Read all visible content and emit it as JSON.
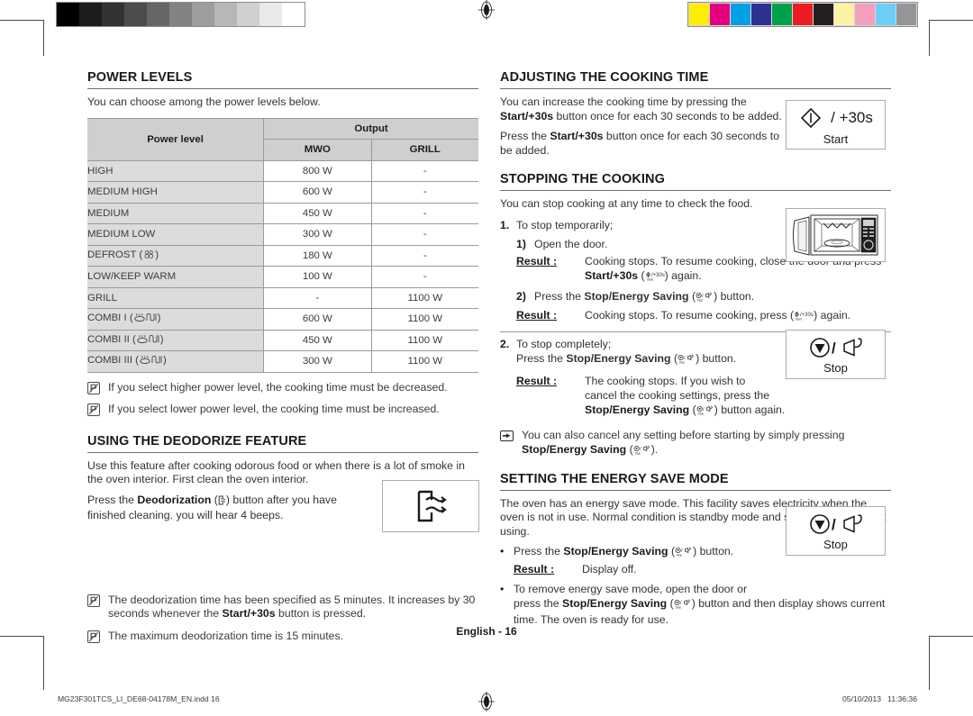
{
  "document": {
    "page_label": "English - 16",
    "footer_file": "MG23F301TCS_LI_DE68-04178M_EN.indd   16",
    "footer_page_num": "16",
    "footer_date": "05/10/2013   11:36:36"
  },
  "calibration": {
    "gray_bar_name": "grayscale-calibration-bar",
    "gray_steps": [
      "#000000",
      "#1c1c1c",
      "#323232",
      "#4c4c4c",
      "#666666",
      "#828282",
      "#9e9e9e",
      "#b7b7b7",
      "#d0d0d0",
      "#e9e9e9",
      "#ffffff"
    ],
    "color_bar_name": "color-calibration-bar",
    "color_steps": [
      "#ffed00",
      "#e5007d",
      "#00a0e4",
      "#2e3192",
      "#00a14b",
      "#ed1c24",
      "#231f20",
      "#fbf2a6",
      "#f4a0bd",
      "#6dcff6",
      "#939598"
    ]
  },
  "left_column": {
    "power_levels": {
      "title": "POWER LEVELS",
      "intro": "You can choose among the power levels below.",
      "table": {
        "header_power_level": "Power level",
        "header_output": "Output",
        "header_mwo": "MWO",
        "header_grill": "GRILL",
        "rows": [
          {
            "level": "HIGH",
            "icon": "",
            "mwo": "800 W",
            "grill": "-"
          },
          {
            "level": "MEDIUM HIGH",
            "icon": "",
            "mwo": "600 W",
            "grill": "-"
          },
          {
            "level": "MEDIUM",
            "icon": "",
            "mwo": "450 W",
            "grill": "-"
          },
          {
            "level": "MEDIUM LOW",
            "icon": "",
            "mwo": "300 W",
            "grill": "-"
          },
          {
            "level": "DEFROST",
            "icon": "defrost-icon",
            "mwo": "180 W",
            "grill": "-"
          },
          {
            "level": "LOW/KEEP WARM",
            "icon": "",
            "mwo": "100 W",
            "grill": "-"
          },
          {
            "level": "GRILL",
            "icon": "",
            "mwo": "-",
            "grill": "1100 W"
          },
          {
            "level": "COMBI I",
            "icon": "combi-icon",
            "mwo": "600 W",
            "grill": "1100 W"
          },
          {
            "level": "COMBI II",
            "icon": "combi-icon",
            "mwo": "450 W",
            "grill": "1100 W"
          },
          {
            "level": "COMBI III",
            "icon": "combi-icon",
            "mwo": "300 W",
            "grill": "1100 W"
          }
        ]
      },
      "notes": [
        "If you select higher power level, the cooking time must be decreased.",
        "If you select lower power level, the cooking time must be increased."
      ]
    },
    "deodorize": {
      "title": "USING THE DEODORIZE FEATURE",
      "para1": "Use this feature after cooking odorous food or when there is a lot of smoke in the oven interior. First clean the oven interior.",
      "para2_pre": "Press the ",
      "para2_bold": "Deodorization",
      "para2_mid": " (",
      "para2_post": ") button after you have finished cleaning. you will hear 4 beeps.",
      "notes": [
        {
          "pre": "The deodorization time has been specified as 5 minutes. It increases by 30 seconds whenever the ",
          "bold": "Start/+30s",
          "post": " button is pressed."
        },
        {
          "pre": "The maximum deodorization time is 15 minutes.",
          "bold": "",
          "post": ""
        }
      ],
      "figure_name": "deodorization-icon-box"
    }
  },
  "right_column": {
    "adjusting": {
      "title": "ADJUSTING THE COOKING TIME",
      "para1_pre": "You can increase the cooking time by pressing the ",
      "para1_bold": "Start/+30s",
      "para1_post": " button once for each 30 seconds to be added.",
      "para2_pre": "Press the ",
      "para2_bold": "Start/+30s",
      "para2_post": " button once for each 30 seconds to be added.",
      "figure": {
        "label": "Start",
        "plus_text": "/ +30s",
        "name": "start-key-figure"
      }
    },
    "stopping": {
      "title": "STOPPING THE COOKING",
      "intro": "You can stop cooking at any time to check the food.",
      "step1_num": "1.",
      "step1_text": "To stop temporarily;",
      "sub1_num": "1)",
      "sub1_text": "Open the door.",
      "result_label": "Result :",
      "result1_pre": "Cooking stops. To resume cooking, close the door and press ",
      "result1_bold": "Start/+30s",
      "result1_post": " (",
      "result1_end": ") again.",
      "sub2_num": "2)",
      "sub2_pre": "Press the ",
      "sub2_bold": "Stop/Energy Saving",
      "sub2_post": " (",
      "sub2_end": ") button.",
      "result2_pre": "Cooking stops. To resume cooking, press (",
      "result2_end": ") again.",
      "step2_num": "2.",
      "step2_text": "To stop completely;",
      "step2_line2_pre": "Press the ",
      "step2_line2_bold": "Stop/Energy Saving",
      "step2_line2_post": " (",
      "step2_line2_end": ") button.",
      "result3_line1": "The cooking stops. If you wish to",
      "result3_line2": "cancel the cooking settings, press the",
      "result3_bold": "Stop/Energy Saving",
      "result3_mid": " (",
      "result3_end": ") button again.",
      "hand_pre": "You can also cancel any setting before starting by simply pressing ",
      "hand_bold": "Stop/Energy Saving",
      "hand_mid": " (",
      "hand_end": ").",
      "oven_figure_name": "microwave-oven-open-door-figure",
      "stop_figure": {
        "label": "Stop",
        "name": "stop-key-figure"
      }
    },
    "energy_save": {
      "title": "SETTING THE ENERGY SAVE MODE",
      "intro": "The oven has an energy save mode. This facility saves electricity when the oven is not in use. Normal condition is standby mode and show clock when not using.",
      "bullet1_pre": "Press the ",
      "bullet1_bold": "Stop/Energy Saving",
      "bullet1_post": " (",
      "bullet1_end": ") button.",
      "result_label": "Result :",
      "result_text": "Display off.",
      "bullet2_line1": "To remove energy save mode, open the door or",
      "bullet2_line2_pre": "press the ",
      "bullet2_line2_bold": "Stop/Energy Saving",
      "bullet2_line2_post": " (",
      "bullet2_line2_end": ") button and then display shows current time. The oven is ready for use.",
      "stop_figure": {
        "label": "Stop",
        "name": "stop-key-figure"
      }
    }
  }
}
